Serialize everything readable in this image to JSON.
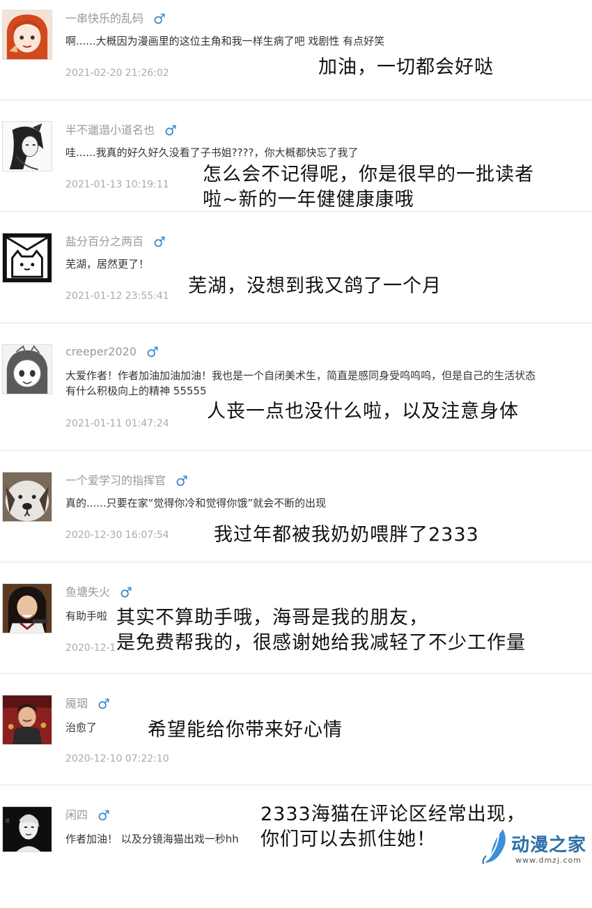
{
  "comments": [
    {
      "username": "一串快乐的乱码",
      "gender": "♂",
      "text": [
        "啊......大概因为漫画里的这位主角和我一样生病了吧 戏剧性 有点好笑"
      ],
      "time": "2021-02-20 21:26:02",
      "reply": [
        "加油，一切都会好哒"
      ]
    },
    {
      "username": "半不邋遢小道名也",
      "gender": "♂",
      "text": [
        "哇......我真的好久好久没看了子书姐????，你大概都快忘了我了"
      ],
      "time": "2021-01-13 10:19:11",
      "reply": [
        "怎么会不记得呢，你是很早的一批读者",
        "啦~新的一年健健康康哦"
      ]
    },
    {
      "username": "盐分百分之两百",
      "gender": "♂",
      "text": [
        "芜湖，居然更了！"
      ],
      "time": "2021-01-12 23:55:41",
      "reply": [
        "芜湖，没想到我又鸽了一个月"
      ]
    },
    {
      "username": "creeper2020",
      "gender": "♂",
      "text": [
        "大爱作者！作者加油加油加油！我也是一个自闭美术生，简直是感同身受呜呜呜，但是自己的生活状态",
        "有什么积极向上的精神 55555"
      ],
      "time": "2021-01-11 01:47:24",
      "reply": [
        "人丧一点也没什么啦，以及注意身体"
      ]
    },
    {
      "username": "一个爱学习的指挥官",
      "gender": "♂",
      "text": [
        "真的......只要在家“觉得你冷和觉得你饿”就会不断的出现"
      ],
      "time": "2020-12-30 16:07:54",
      "reply": [
        "我过年都被我奶奶喂胖了2333"
      ]
    },
    {
      "username": "鱼塘失火",
      "gender": "♂",
      "text": [
        "有助手啦"
      ],
      "time": "2020-12-1",
      "reply": [
        "其实不算助手哦，海哥是我的朋友，",
        "是免费帮我的，很感谢她给我减轻了不少工作量"
      ]
    },
    {
      "username": "魇珚",
      "gender": "♂",
      "text": [
        "治愈了"
      ],
      "time": "2020-12-10 07:22:10",
      "reply": [
        "希望能给你带来好心情"
      ]
    },
    {
      "username": "闲四",
      "gender": "♂",
      "text": [
        "作者加油！ 以及分镜海猫出戏一秒hh"
      ],
      "time": "",
      "reply": [
        "2333海猫在评论区经常出现，",
        "你们可以去抓住她！"
      ]
    }
  ],
  "watermark": {
    "name": "动漫之家",
    "url": "www.dmzj.com"
  }
}
